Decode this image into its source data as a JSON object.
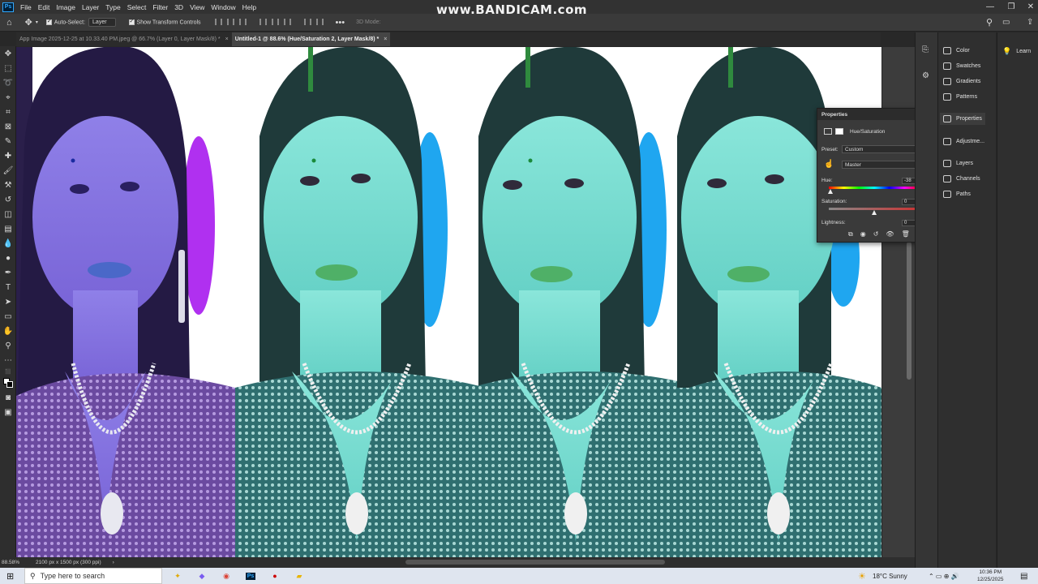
{
  "watermark": "www.BANDICAM.com",
  "menu": [
    "File",
    "Edit",
    "Image",
    "Type",
    "Select",
    "Filter",
    "3D",
    "View",
    "Window",
    "Help"
  ],
  "options": {
    "auto_select_label": "Auto-Select:",
    "auto_select_value": "Layer",
    "show_transform_label": "Show Transform Controls",
    "mode_label": "3D Mode:"
  },
  "tabs": [
    {
      "label": "App Image 2025-12-25 at 10.33.40 PM.jpeg @ 66.7% (Layer 0, Layer Mask/8) *",
      "active": false
    },
    {
      "label": "Untitled-1 @ 88.6% (Hue/Saturation 2, Layer Mask/8) *",
      "active": true
    }
  ],
  "status": {
    "zoom": "88.58%",
    "doc_size": "2100 px x 1500 px (300 ppi)"
  },
  "properties": {
    "title": "Properties",
    "adjustment_name": "Hue/Saturation",
    "preset_label": "Preset:",
    "preset_value": "Custom",
    "channel_value": "Master",
    "hue_label": "Hue:",
    "hue_value": "-38",
    "hue_position": 0.02,
    "saturation_label": "Saturation:",
    "saturation_value": "0",
    "saturation_position": 0.5,
    "lightness_label": "Lightness:",
    "lightness_value": "0"
  },
  "panels": [
    {
      "label": "Color",
      "icon": "color-icon"
    },
    {
      "label": "Swatches",
      "icon": "swatches-icon"
    },
    {
      "label": "Gradients",
      "icon": "gradients-icon"
    },
    {
      "label": "Patterns",
      "icon": "patterns-icon"
    },
    {
      "label": "Properties",
      "icon": "properties-icon",
      "active": true
    },
    {
      "label": "Adjustme...",
      "icon": "adjustments-icon"
    },
    {
      "label": "Layers",
      "icon": "layers-icon"
    },
    {
      "label": "Channels",
      "icon": "channels-icon"
    },
    {
      "label": "Paths",
      "icon": "paths-icon"
    }
  ],
  "learn_label": "Learn",
  "taskbar": {
    "search_placeholder": "Type here to search",
    "weather": "18°C  Sunny",
    "time": "10:36 PM",
    "date": "12/25/2025"
  },
  "colors": {
    "figure1_skin": "#9580ee",
    "figure_skin": "#7fe0d4",
    "figure1_flowers": "#b030f0",
    "figure_flowers": "#1fa6f0",
    "accent": "#31a8ff"
  }
}
